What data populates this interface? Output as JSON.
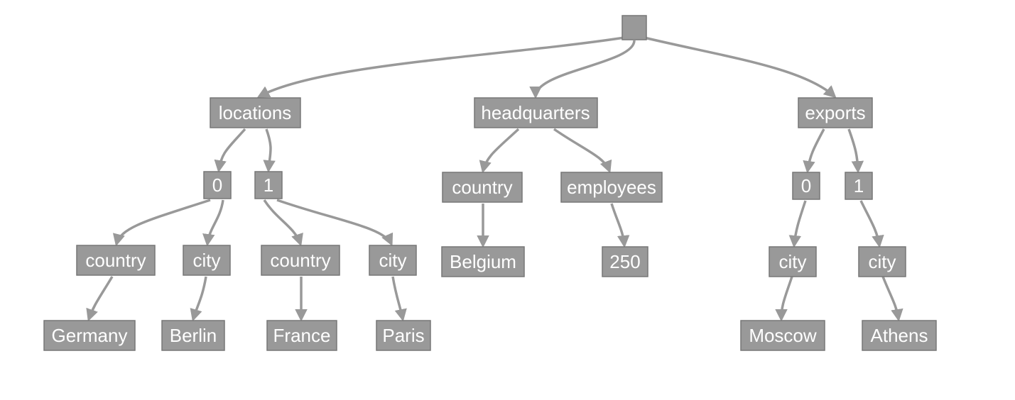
{
  "tree": {
    "root": "",
    "locations": {
      "label": "locations",
      "idx0": "0",
      "idx1": "1",
      "item0": {
        "country_label": "country",
        "city_label": "city",
        "country": "Germany",
        "city": "Berlin"
      },
      "item1": {
        "country_label": "country",
        "city_label": "city",
        "country": "France",
        "city": "Paris"
      }
    },
    "headquarters": {
      "label": "headquarters",
      "country_label": "country",
      "employees_label": "employees",
      "country": "Belgium",
      "employees": "250"
    },
    "exports": {
      "label": "exports",
      "idx0": "0",
      "idx1": "1",
      "item0": {
        "city_label": "city",
        "city": "Moscow"
      },
      "item1": {
        "city_label": "city",
        "city": "Athens"
      }
    }
  }
}
